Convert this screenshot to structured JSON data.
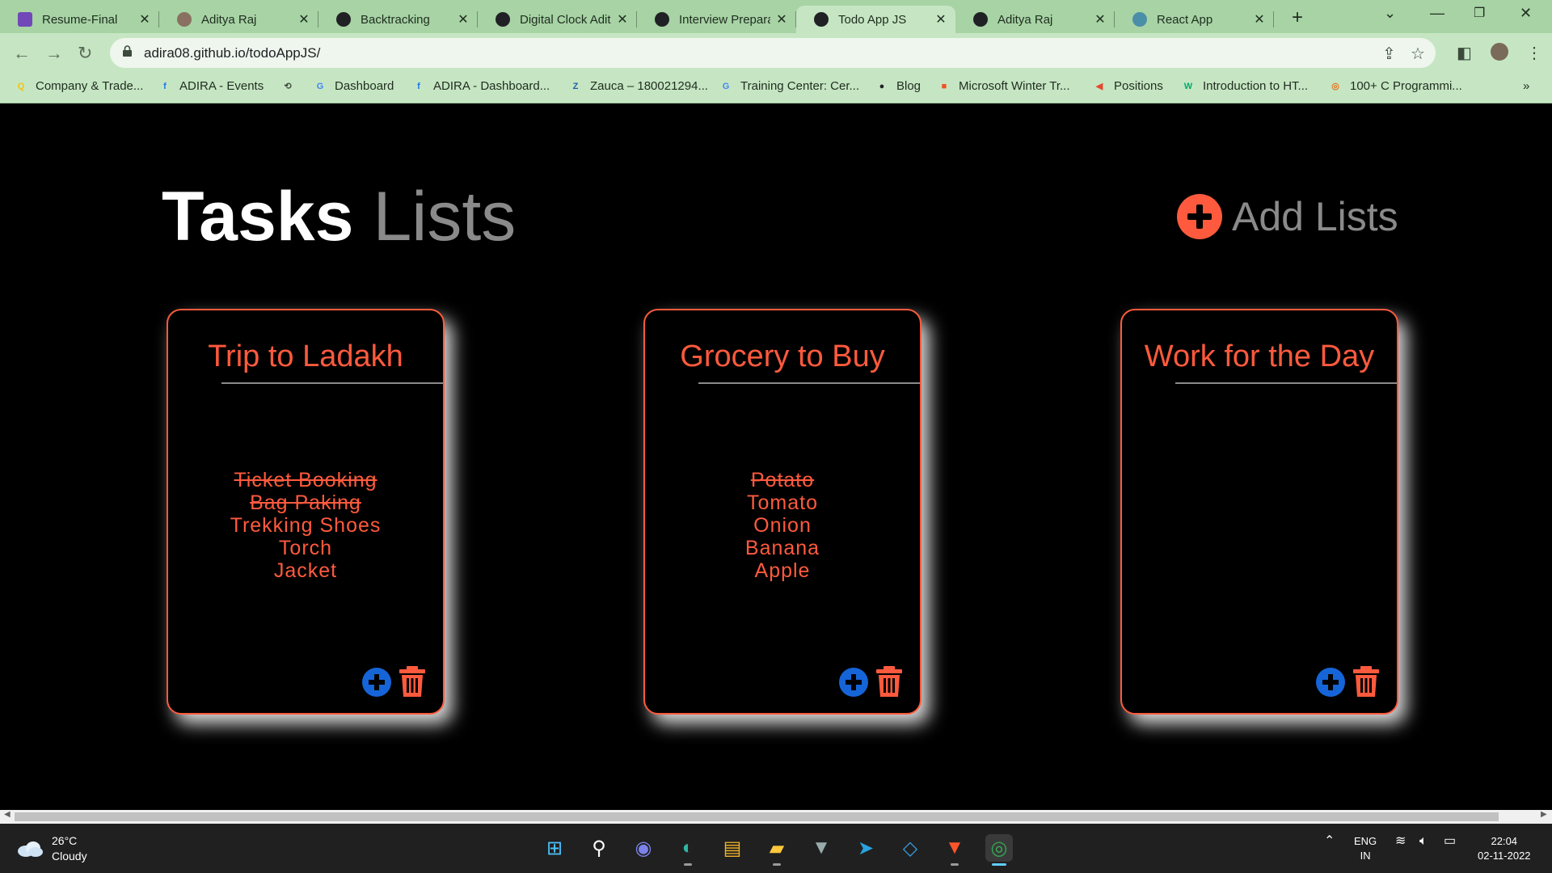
{
  "browser": {
    "tabs": [
      {
        "title": "Resume-Final",
        "icon": "forms-icon",
        "color": "#7248b9"
      },
      {
        "title": "Aditya Raj",
        "icon": "profile-icon",
        "color": "#8a7060"
      },
      {
        "title": "Backtracking",
        "icon": "globe-icon",
        "color": "#202124"
      },
      {
        "title": "Digital Clock Adit",
        "icon": "globe-icon",
        "color": "#202124"
      },
      {
        "title": "Interview Prepara",
        "icon": "globe-icon",
        "color": "#202124"
      },
      {
        "title": "Todo App JS",
        "icon": "globe-icon",
        "color": "#202124",
        "active": true
      },
      {
        "title": "Aditya Raj",
        "icon": "globe-icon",
        "color": "#202124"
      },
      {
        "title": "React App",
        "icon": "react-icon",
        "color": "#4b8ea8"
      }
    ],
    "url": "adira08.github.io/todoAppJS/",
    "bookmarks": [
      {
        "label": "Company & Trade...",
        "icon": "q-icon",
        "glyph": "Q",
        "color": "#f4c20d"
      },
      {
        "label": "ADIRA - Events",
        "icon": "facebook-icon",
        "glyph": "f",
        "color": "#1877f2"
      },
      {
        "label": "",
        "icon": "history-icon",
        "glyph": "⟲",
        "color": "#3c4a3c"
      },
      {
        "label": "Dashboard",
        "icon": "google-icon",
        "glyph": "G",
        "color": "#4285f4"
      },
      {
        "label": "ADIRA - Dashboard...",
        "icon": "facebook-icon",
        "glyph": "f",
        "color": "#1877f2"
      },
      {
        "label": "Zauca – 180021294...",
        "icon": "zauca-icon",
        "glyph": "Z",
        "color": "#1f5fa8"
      },
      {
        "label": "Training Center: Cer...",
        "icon": "google-icon",
        "glyph": "G",
        "color": "#4285f4"
      },
      {
        "label": "Blog",
        "icon": "globe-icon",
        "glyph": "●",
        "color": "#202124"
      },
      {
        "label": "Microsoft Winter Tr...",
        "icon": "microsoft-icon",
        "glyph": "■",
        "color": "#f25022"
      },
      {
        "label": "Positions",
        "icon": "positions-icon",
        "glyph": "◀",
        "color": "#e8452c"
      },
      {
        "label": "Introduction to HT...",
        "icon": "w3-icon",
        "glyph": "W",
        "color": "#04aa6d"
      },
      {
        "label": "100+ C Programmi...",
        "icon": "c-program-icon",
        "glyph": "◎",
        "color": "#e0761e"
      }
    ]
  },
  "app": {
    "title_strong": "Tasks",
    "title_light": "Lists",
    "add_lists_label": "Add Lists",
    "accent": "#ff5a3d",
    "add_color": "#1565d8",
    "lists": [
      {
        "title": "Trip to Ladakh",
        "items": [
          {
            "text": "Ticket Booking",
            "done": true
          },
          {
            "text": "Bag Paking",
            "done": true
          },
          {
            "text": "Trekking Shoes",
            "done": false
          },
          {
            "text": "Torch",
            "done": false
          },
          {
            "text": "Jacket",
            "done": false
          }
        ]
      },
      {
        "title": "Grocery to Buy",
        "items": [
          {
            "text": "Potato",
            "done": true
          },
          {
            "text": "Tomato",
            "done": false
          },
          {
            "text": "Onion",
            "done": false
          },
          {
            "text": "Banana",
            "done": false
          },
          {
            "text": "Apple",
            "done": false
          }
        ]
      },
      {
        "title": "Work for the Day",
        "items": []
      }
    ]
  },
  "taskbar": {
    "temperature": "26°C",
    "weather": "Cloudy",
    "language_top": "ENG",
    "language_bottom": "IN",
    "time": "22:04",
    "date": "02-11-2022",
    "apps": [
      "start-icon",
      "search-icon",
      "chat-icon",
      "edge-icon",
      "store-icon",
      "file-explorer-icon",
      "predator-icon",
      "telegram-icon",
      "vscode-icon",
      "brave-icon",
      "chrome-icon"
    ]
  }
}
